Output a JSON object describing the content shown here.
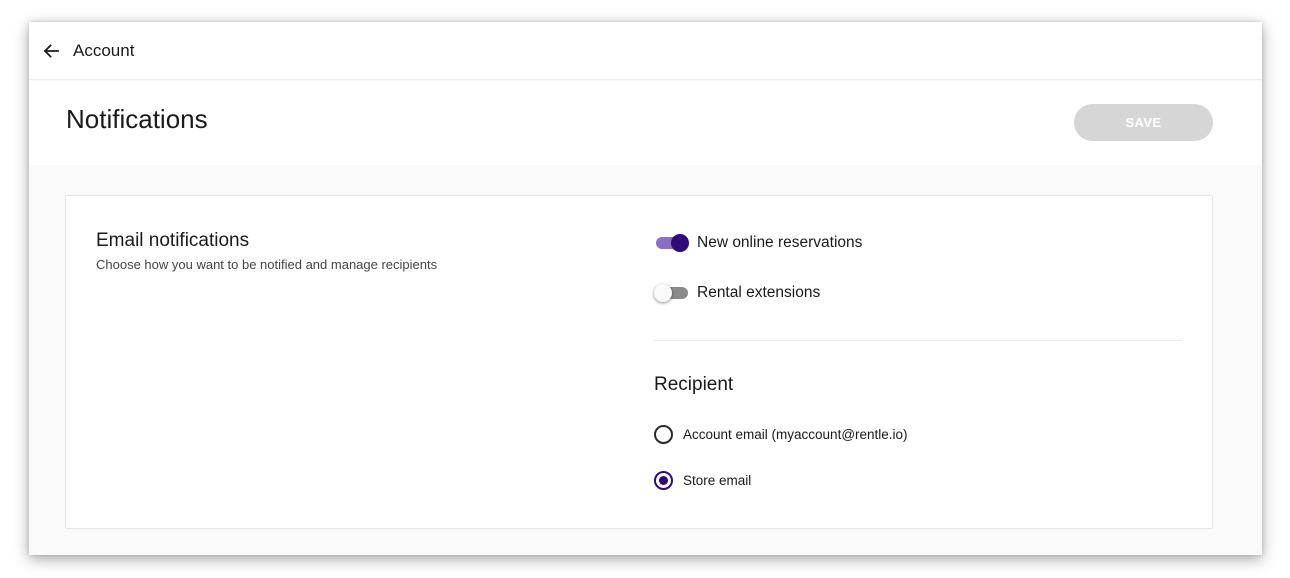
{
  "topbar": {
    "back_icon": "arrow-left-icon",
    "title": "Account"
  },
  "header": {
    "title": "Notifications",
    "save_label": "SAVE",
    "save_disabled": true
  },
  "email_notifications": {
    "title": "Email notifications",
    "description": "Choose how you want to be notified and manage recipients",
    "toggles": [
      {
        "label": "New online reservations",
        "enabled": true
      },
      {
        "label": "Rental extensions",
        "enabled": false
      }
    ]
  },
  "recipient": {
    "title": "Recipient",
    "options": [
      {
        "label": "Account email (myaccount@rentle.io)",
        "selected": false
      },
      {
        "label": "Store email",
        "selected": true
      }
    ]
  },
  "colors": {
    "accent": "#2e0a7a",
    "toggle_track_on": "#8a6fc4",
    "save_disabled_bg": "#d6d6d6"
  }
}
